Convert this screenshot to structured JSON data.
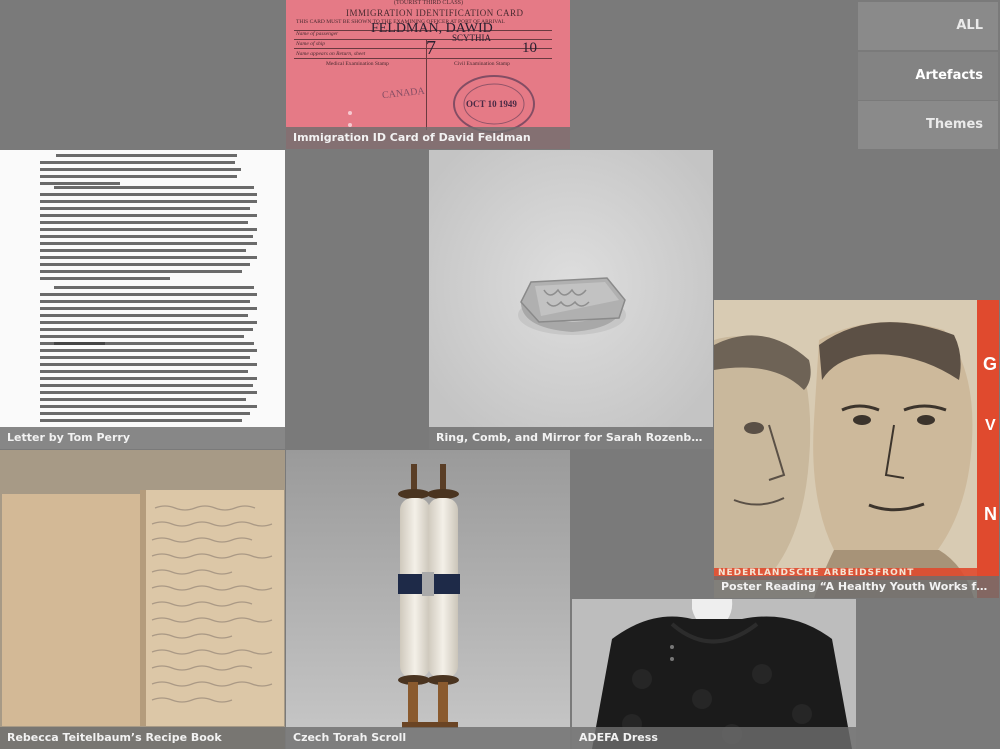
{
  "nav": {
    "all_label": "ALL",
    "artefacts_label": "Artefacts",
    "themes_label": "Themes"
  },
  "tiles": [
    {
      "caption": "Immigration ID Card of David Feldman"
    },
    {
      "caption": "Letter by Tom Perry"
    },
    {
      "caption": "Ring, Comb, and Mirror for Sarah Rozenberg-Warm"
    },
    {
      "caption": "Poster Reading “A Healthy Youth Works for the Ne..."
    },
    {
      "caption": "Rebecca Teitelbaum’s Recipe Book"
    },
    {
      "caption": "Czech Torah Scroll"
    },
    {
      "caption": "ADEFA Dress"
    }
  ],
  "card": {
    "header_small": "(TOURIST THIRD CLASS)",
    "title": "IMMIGRATION IDENTIFICATION CARD",
    "subtitle": "THIS CARD MUST BE SHOWN TO THE EXAMINING OFFICER AT PORT OF ARRIVAL",
    "name_label": "Name of passenger",
    "name_value": "FELDMAN, DAWID",
    "ship_label": "Name of ship",
    "ship_value": "SCYTHIA",
    "manifest_label": "Name appears on Return, sheet",
    "sheet_value": "7",
    "line_value": "10",
    "medical_label": "Medical Examination Stamp",
    "civil_label": "Civil Examination Stamp",
    "stamp_text": "OCT 10 1949",
    "stamp_port": "CANADA"
  },
  "poster": {
    "band_text": "NEDERLANDSCHE ARBEIDSFRONT"
  },
  "colors": {
    "background": "#7a7a7a",
    "caption_bg": "#6e6e6e",
    "nav_bg": "#8a8a8a",
    "card_pink": "#e57a86",
    "poster_red": "#e04a2e"
  }
}
